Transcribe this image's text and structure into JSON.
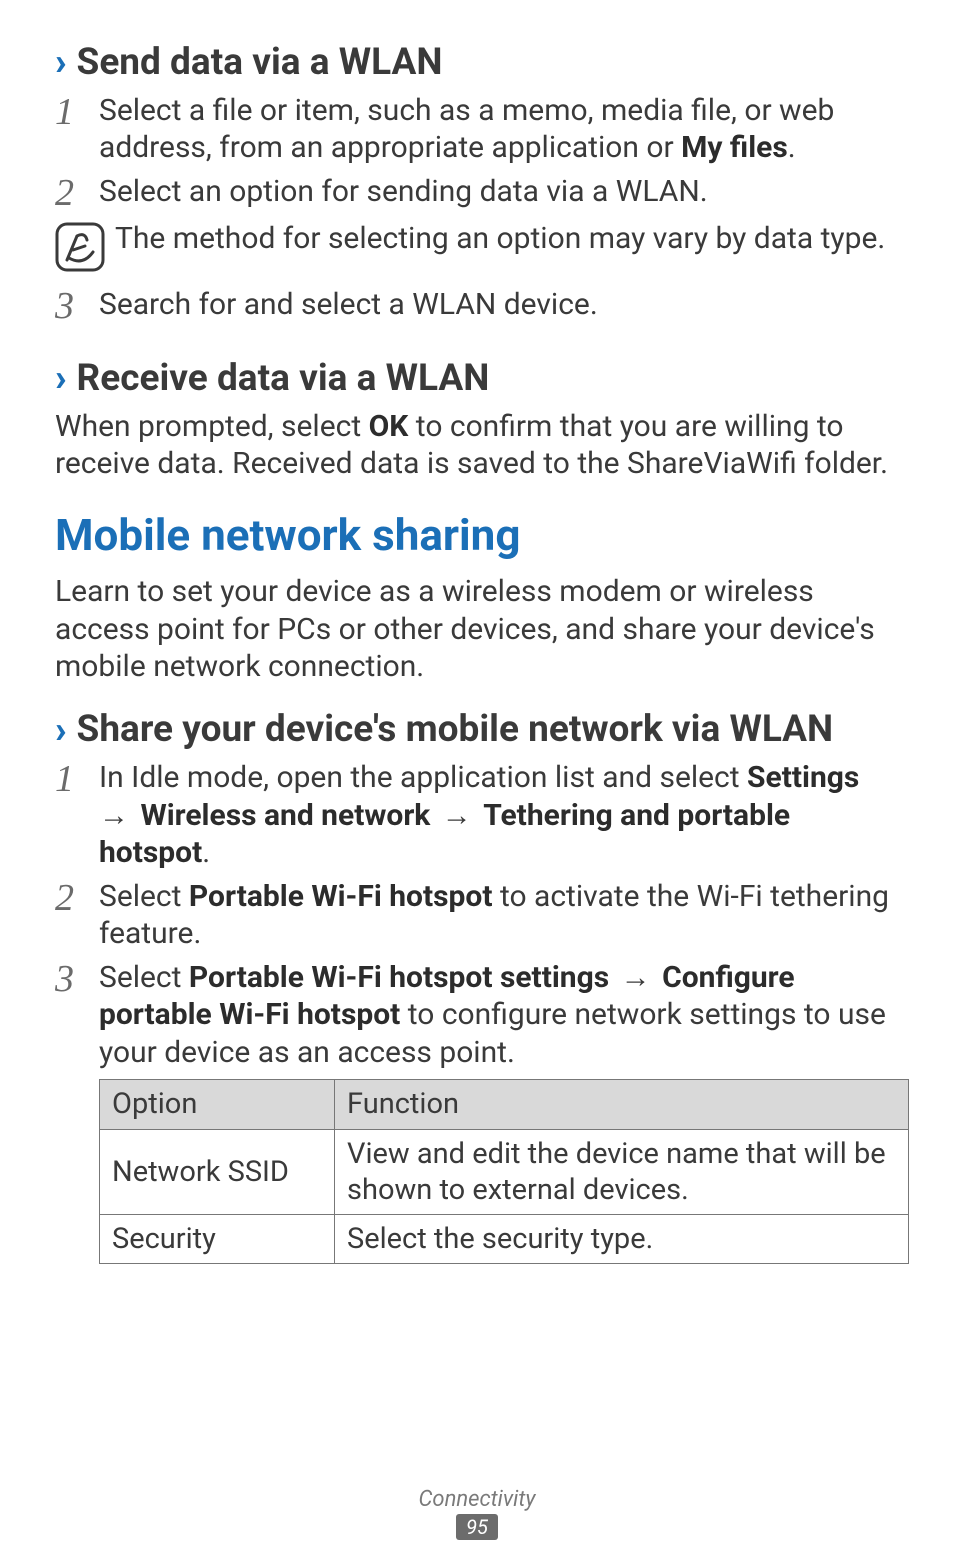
{
  "section1": {
    "heading": "Send data via a WLAN",
    "steps": [
      {
        "num": "1",
        "pre": "Select a file or item, such as a memo, media file, or web address, from an appropriate application or ",
        "bold1": "My files",
        "post": "."
      },
      {
        "num": "2",
        "pre": "Select an option for sending data via a WLAN."
      }
    ],
    "note": "The method for selecting an option may vary by data type.",
    "step3": {
      "num": "3",
      "pre": "Search for and select a WLAN device."
    }
  },
  "section2": {
    "heading": "Receive data via a WLAN",
    "para_pre": "When prompted, select ",
    "para_bold": "OK",
    "para_post": " to confirm that you are willing to receive data. Received data is saved to the ShareViaWifi folder."
  },
  "main": {
    "heading": "Mobile network sharing",
    "intro": "Learn to set your device as a wireless modem or wireless access point for PCs or other devices, and share your device's mobile network connection."
  },
  "section3": {
    "heading": "Share your device's mobile network via WLAN",
    "steps": {
      "s1": {
        "num": "1",
        "pre": "In Idle mode, open the application list and select ",
        "b1": "Settings",
        "arrow": " → ",
        "b2": "Wireless and network",
        "b3": "Tethering and portable hotspot",
        "post": "."
      },
      "s2": {
        "num": "2",
        "pre": "Select ",
        "b1": "Portable Wi-Fi hotspot",
        "post": " to activate the Wi-Fi tethering feature."
      },
      "s3": {
        "num": "3",
        "pre": "Select ",
        "b1": "Portable Wi-Fi hotspot settings",
        "arrow": " → ",
        "b2": "Configure portable Wi-Fi hotspot",
        "post": " to configure network settings to use your device as an access point."
      }
    },
    "table": {
      "head_option": "Option",
      "head_function": "Function",
      "rows": [
        {
          "option": "Network SSID",
          "function": "View and edit the device name that will be shown to external devices."
        },
        {
          "option": "Security",
          "function": "Select the security type."
        }
      ]
    }
  },
  "footer": {
    "label": "Connectivity",
    "page": "95"
  }
}
